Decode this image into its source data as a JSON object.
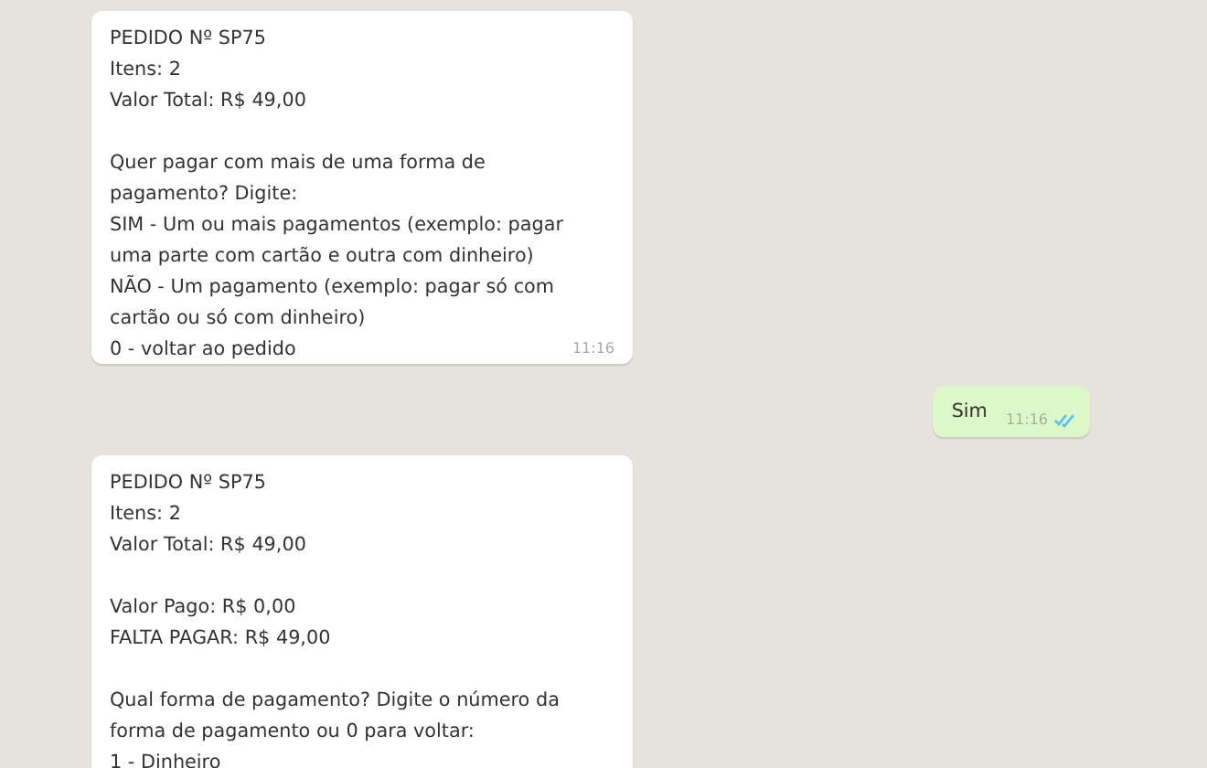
{
  "messages": [
    {
      "kind": "incoming",
      "blocks": [
        [
          "PEDIDO Nº SP75",
          "Itens: 2",
          "Valor Total: R$ 49,00"
        ],
        [
          "Quer pagar com mais de uma forma de",
          "pagamento? Digite:",
          "SIM - Um ou mais pagamentos (exemplo: pagar",
          "uma parte com cartão e outra com dinheiro)",
          "NÃO - Um pagamento (exemplo: pagar só com",
          "cartão ou só com dinheiro)",
          "0 - voltar ao pedido"
        ]
      ],
      "time": "11:16"
    },
    {
      "kind": "outgoing",
      "blocks": [
        [
          "Sim"
        ]
      ],
      "time": "11:16",
      "read": true
    },
    {
      "kind": "incoming",
      "blocks": [
        [
          "PEDIDO Nº SP75",
          "Itens: 2",
          "Valor Total: R$ 49,00"
        ],
        [
          "Valor Pago: R$ 0,00",
          "FALTA PAGAR: R$ 49,00"
        ],
        [
          "Qual forma de pagamento? Digite o número da",
          "forma de pagamento ou 0 para voltar:",
          "1 - Dinheiro"
        ]
      ]
    }
  ]
}
